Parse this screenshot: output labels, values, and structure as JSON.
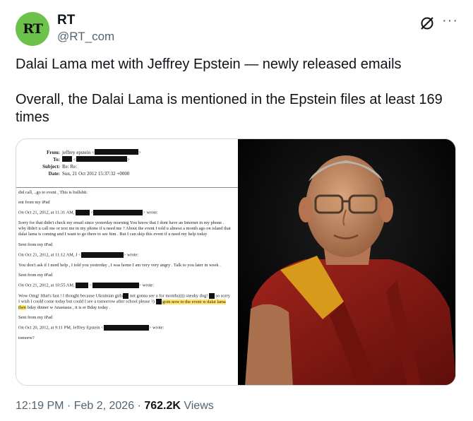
{
  "author": {
    "name": "RT",
    "handle": "@RT_com",
    "avatar_text": "RT"
  },
  "tweet": {
    "line1": "Dalai Lama met with Jeffrey Epstein — newly released emails",
    "line2": "Overall, the Dalai Lama is mentioned in the Epstein files at least 169 times"
  },
  "icons": {
    "grok": "slashed-circle-icon",
    "more": "more-horizontal-icon",
    "more_glyph": "···"
  },
  "document": {
    "header": {
      "from_label": "From:",
      "from_value": "jeffrey epstein <",
      "to_label": "To:",
      "subject_label": "Subject:",
      "subject_value": "Re: Re:",
      "date_label": "Date:",
      "date_value": "Sun, 21 Oct 2012 15:37:32 +0000"
    },
    "body": {
      "l1": "did call, ..go to event ,  This is bullshit.",
      "l2": "ent from my iPad",
      "l3a": "On Oct 21, 2012, at 11:31 AM,",
      "l3b": "> wrote:",
      "l4": "Sorry for that  didn't check my email since yesterday morning You know that I dont have an Internet in my phone  . why didn't u call me or text me in my phone if u need me  ? About the event I told u almost a month ago on island that dalai lama is coming and I want to go there to see him . But I can skip this event if u need my help today",
      "l5": "Sent from my iPad",
      "l6a": "On Oct 21, 2012, at 11:12 AM, J <",
      "l6b": "> wrote:",
      "l7": "You don't ask if I need help , I told you yesterday ,    I was home I am very very angry . Talk to you later in week .",
      "l8": "Sent from my iPad",
      "l9a": "On Oct 21, 2012, at 10:55 AM,",
      "l9b": "> wrote:",
      "l10a": "Wow Omg! Ithat's fast ! I thought because Ukrainian girls",
      "l10b": "not gonna see u for months)))) sneaky dog!",
      "l10c": "so sorry I wish I could come today but could I see u tomorrow after school please ?)",
      "l10d": "goin now to the event w dalai lama then",
      "l10e": "bday dinner w Anastasia  , it is er Bday today .",
      "l11": "Sent from my iPad",
      "l12a": "On Oct 20, 2012, at 9:11 PM, Jeffrey Epstein <",
      "l12b": "> wrote:",
      "l13": "tomorw?"
    }
  },
  "footer": {
    "time": "12:19 PM",
    "sep1": " · ",
    "date": "Feb 2, 2026",
    "sep2": " · ",
    "views_count": "762.2K",
    "views_label": " Views"
  },
  "colors": {
    "avatar_bg": "#6cc24a",
    "muted": "#536471",
    "text": "#0f1419",
    "highlight": "#ffe66b",
    "robe": "#8e1a14",
    "sash": "#d89a1a"
  }
}
